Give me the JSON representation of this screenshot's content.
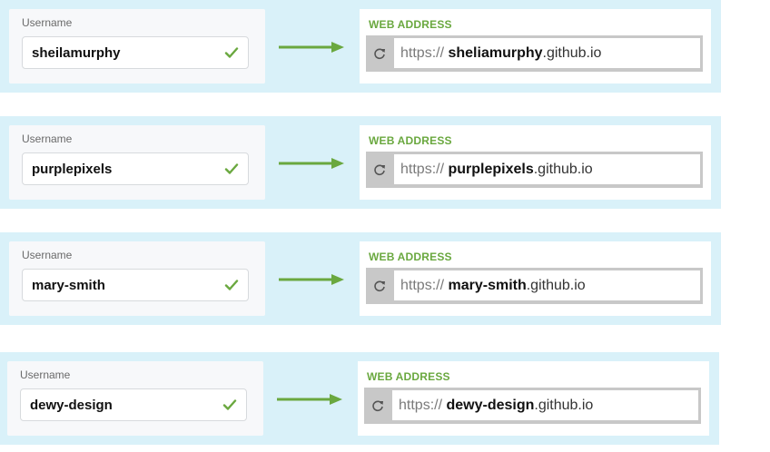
{
  "rows": [
    {
      "username_label": "Username",
      "username": "sheilamurphy",
      "address_title": "WEB ADDRESS",
      "protocol": "https://",
      "site_name": "sheliamurphy",
      "domain": ".github.io"
    },
    {
      "username_label": "Username",
      "username": "purplepixels",
      "address_title": "WEB ADDRESS",
      "protocol": "https://",
      "site_name": "purplepixels",
      "domain": ".github.io"
    },
    {
      "username_label": "Username",
      "username": "mary-smith",
      "address_title": "WEB ADDRESS",
      "protocol": "https://",
      "site_name": "mary-smith",
      "domain": ".github.io"
    },
    {
      "username_label": "Username",
      "username": "dewy-design",
      "address_title": "WEB ADDRESS",
      "protocol": "https://",
      "site_name": "dewy-design",
      "domain": ".github.io"
    }
  ],
  "icons": {
    "check": "check-icon",
    "arrow": "arrow-right-icon",
    "refresh": "refresh-icon"
  },
  "colors": {
    "accent_green": "#6aa83f",
    "row_background": "#d9f1f9"
  }
}
